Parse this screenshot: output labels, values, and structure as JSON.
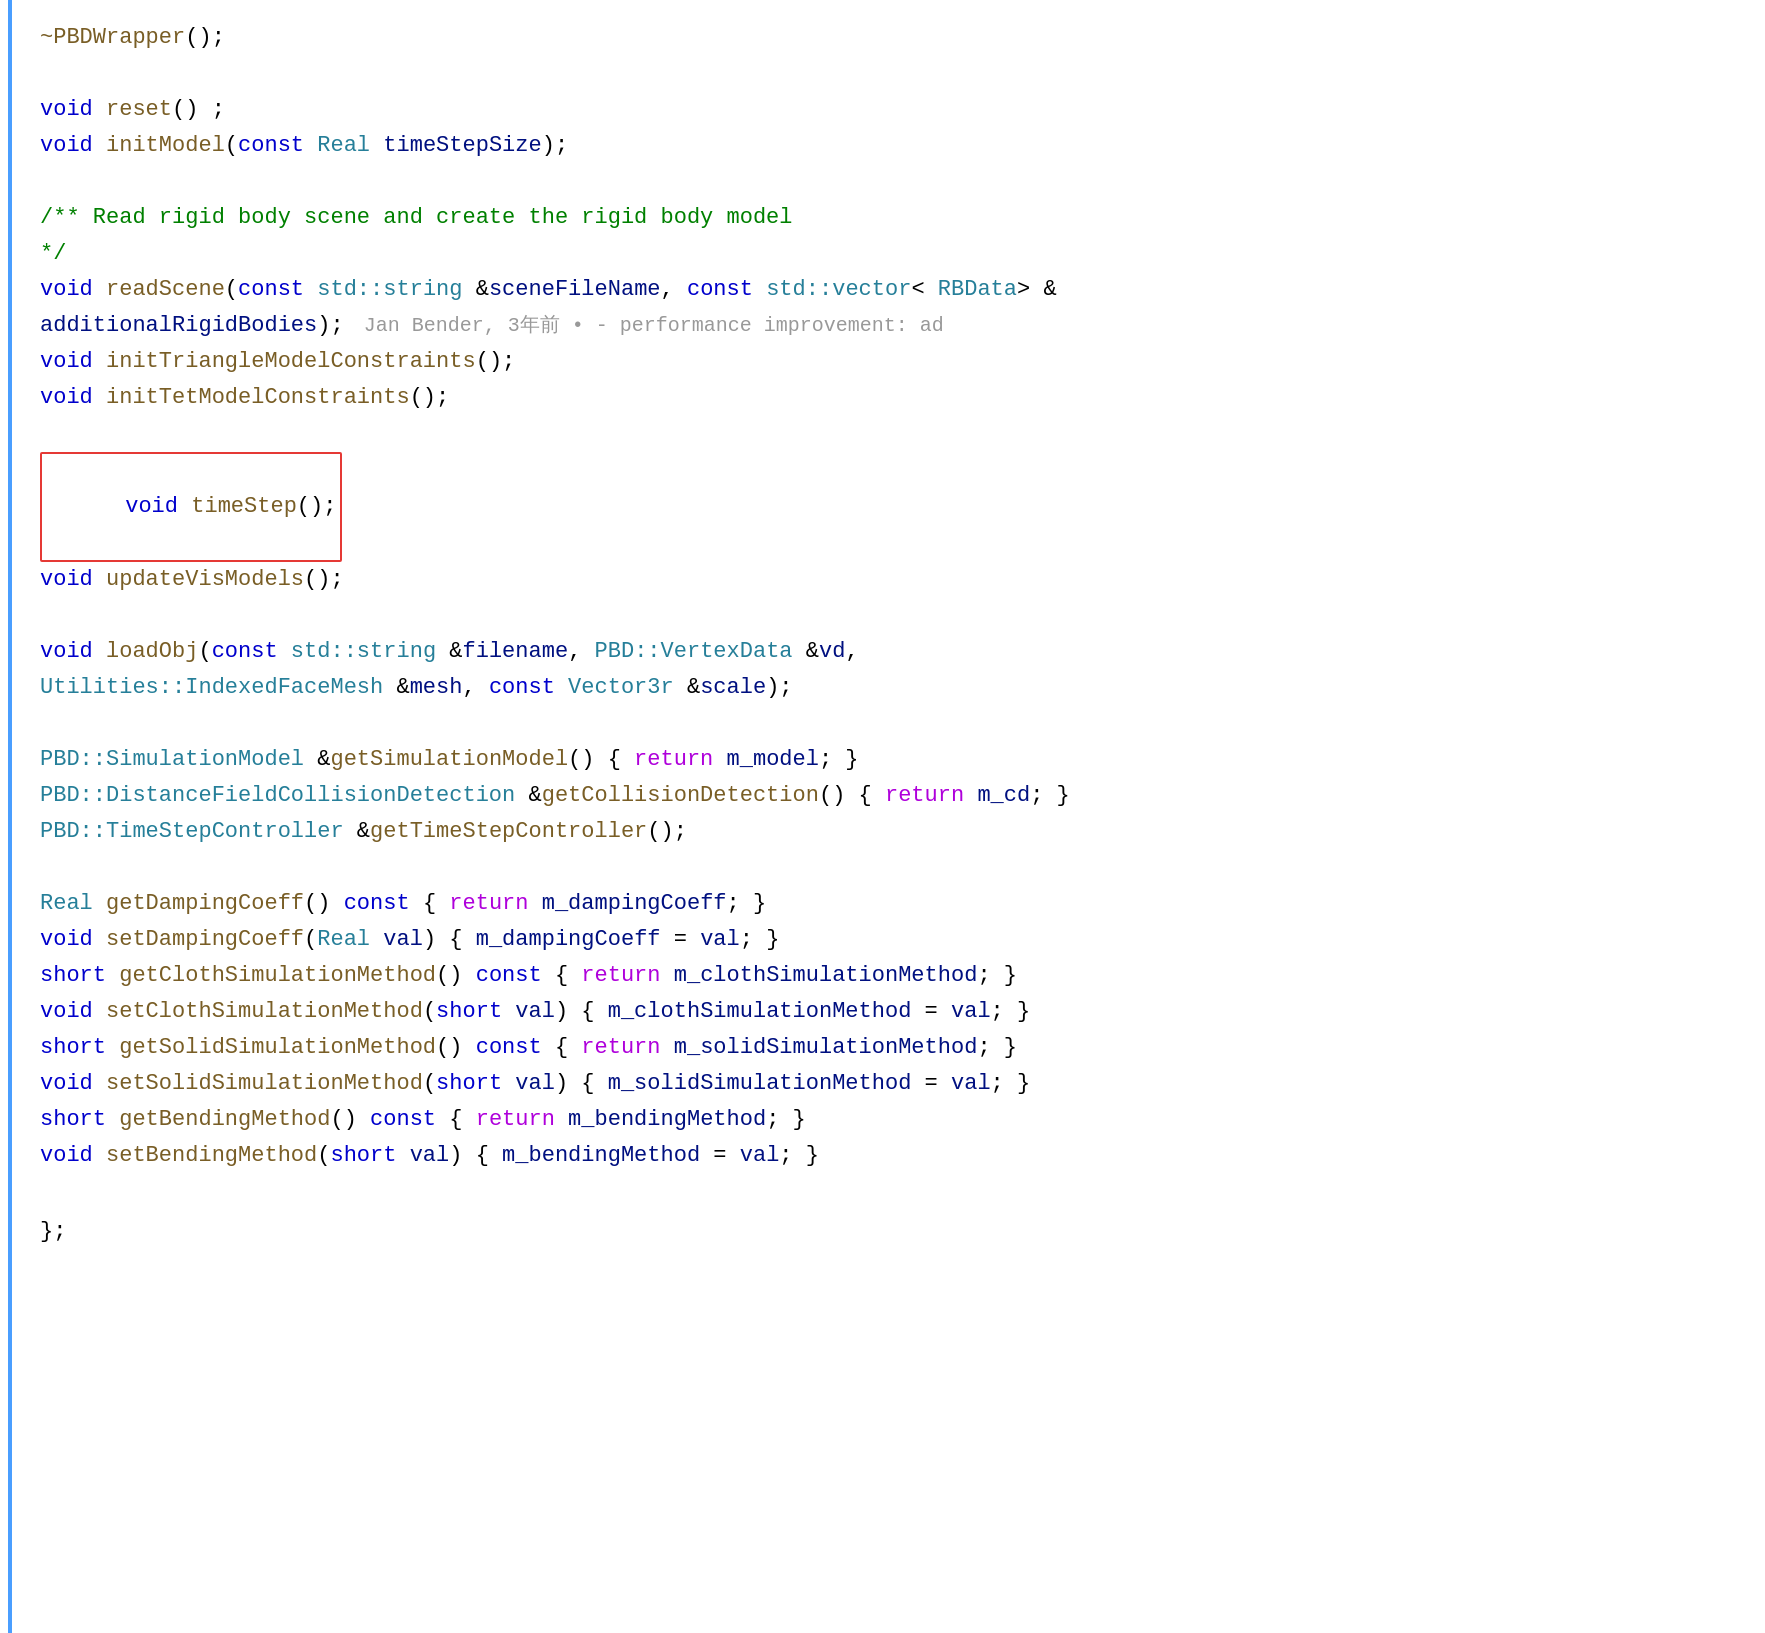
{
  "code": {
    "lines": [
      {
        "id": "line1",
        "content": "~PBDWrapper();"
      },
      {
        "id": "empty1"
      },
      {
        "id": "line2",
        "content": "void reset();"
      },
      {
        "id": "line3",
        "content": "void initModel(const Real timeStepSize);"
      },
      {
        "id": "empty2"
      },
      {
        "id": "line4a",
        "content": "/** Read rigid body scene and create the rigid body model"
      },
      {
        "id": "line4b",
        "content": "*/"
      },
      {
        "id": "line5",
        "content": "void readScene(const std::string &sceneFileName, const std::vector< RBData> &"
      },
      {
        "id": "line6",
        "content": "additionalRigidBodies);",
        "blame": "Jan Bender, 3年前 • - performance improvement: ad"
      },
      {
        "id": "line7",
        "content": "void initTriangleModelConstraints();"
      },
      {
        "id": "line8",
        "content": "void initTetModelConstraints();"
      },
      {
        "id": "empty3"
      },
      {
        "id": "line9",
        "content": "void timeStep();",
        "highlighted": true
      },
      {
        "id": "line10",
        "content": "void updateVisModels();"
      },
      {
        "id": "empty4"
      },
      {
        "id": "line11a",
        "content": "void loadObj(const std::string &filename, PBD::VertexData &vd,"
      },
      {
        "id": "line11b",
        "content": "Utilities::IndexedFaceMesh &mesh, const Vector3r &scale);"
      },
      {
        "id": "empty5"
      },
      {
        "id": "line12",
        "content": "PBD::SimulationModel &getSimulationModel() { return m_model; }"
      },
      {
        "id": "line13",
        "content": "PBD::DistanceFieldCollisionDetection &getCollisionDetection() { return m_cd; }"
      },
      {
        "id": "line14",
        "content": "PBD::TimeStepController &getTimeStepController();"
      },
      {
        "id": "empty6"
      },
      {
        "id": "line15",
        "content": "Real getDampingCoeff() const { return m_dampingCoeff; }"
      },
      {
        "id": "line16",
        "content": "void setDampingCoeff(Real val) { m_dampingCoeff = val; }"
      },
      {
        "id": "line17",
        "content": "short getClothSimulationMethod() const { return m_clothSimulationMethod; }"
      },
      {
        "id": "line18",
        "content": "void setClothSimulationMethod(short val) { m_clothSimulationMethod = val; }"
      },
      {
        "id": "line19",
        "content": "short getSolidSimulationMethod() const { return m_solidSimulationMethod; }"
      },
      {
        "id": "line20",
        "content": "void setSolidSimulationMethod(short val) { m_solidSimulationMethod = val; }"
      },
      {
        "id": "line21",
        "content": "short getBendingMethod() const { return m_bendingMethod; }"
      },
      {
        "id": "line22",
        "content": "void setBendingMethod(short val) { m_bendingMethod = val; }"
      },
      {
        "id": "empty7"
      },
      {
        "id": "line23",
        "content": "};"
      }
    ]
  }
}
